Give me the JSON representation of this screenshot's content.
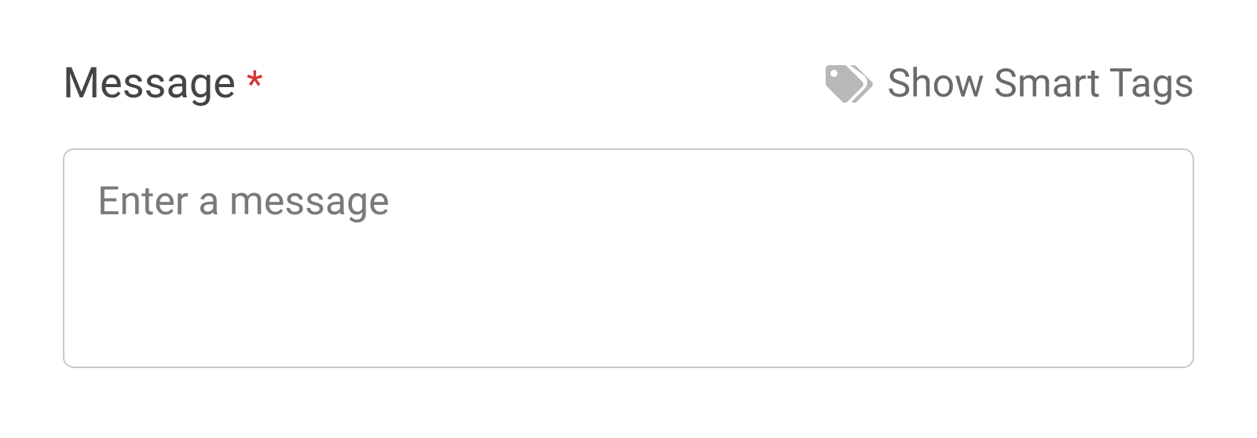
{
  "field": {
    "label": "Message",
    "required_mark": "*",
    "placeholder": "Enter a message",
    "value": ""
  },
  "smart_tags": {
    "link_text": "Show Smart Tags",
    "icon_name": "tags-icon"
  }
}
